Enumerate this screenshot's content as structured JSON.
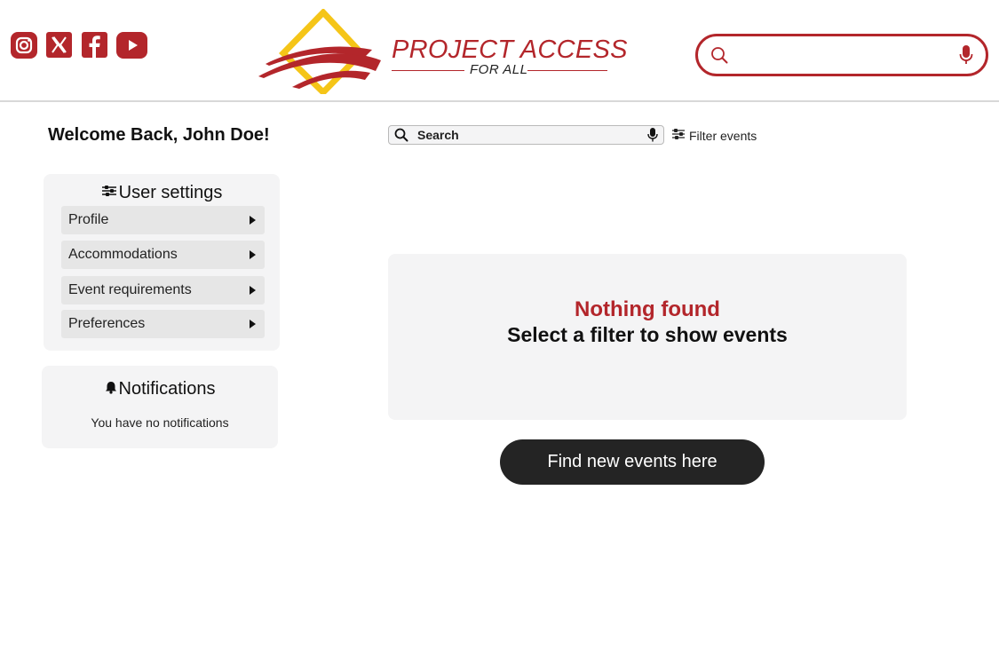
{
  "header": {
    "social": [
      {
        "name": "instagram",
        "icon": "instagram-icon"
      },
      {
        "name": "x",
        "icon": "x-icon"
      },
      {
        "name": "facebook",
        "icon": "facebook-icon"
      },
      {
        "name": "youtube",
        "icon": "youtube-icon"
      }
    ],
    "logo": {
      "title": "PROJECT ACCESS",
      "subtitle": "FOR ALL"
    },
    "search": {
      "placeholder": "",
      "value": ""
    }
  },
  "sidebar": {
    "welcome": "Welcome Back, John Doe!",
    "settings": {
      "title": "User settings",
      "items": [
        {
          "label": "Profile"
        },
        {
          "label": "Accommodations"
        },
        {
          "label": "Event requirements"
        },
        {
          "label": "Preferences"
        }
      ]
    },
    "notifications": {
      "title": "Notifications",
      "empty_text": "You have no notifications"
    }
  },
  "main": {
    "search_label": "Search",
    "filter_label": "Filter events",
    "empty": {
      "title": "Nothing found",
      "subtitle": "Select a filter to show events"
    },
    "cta_label": "Find new events here"
  },
  "colors": {
    "brand_red": "#b3262b",
    "brand_yellow": "#f5c518",
    "panel_bg": "#f4f4f5",
    "button_dark": "#242424"
  }
}
